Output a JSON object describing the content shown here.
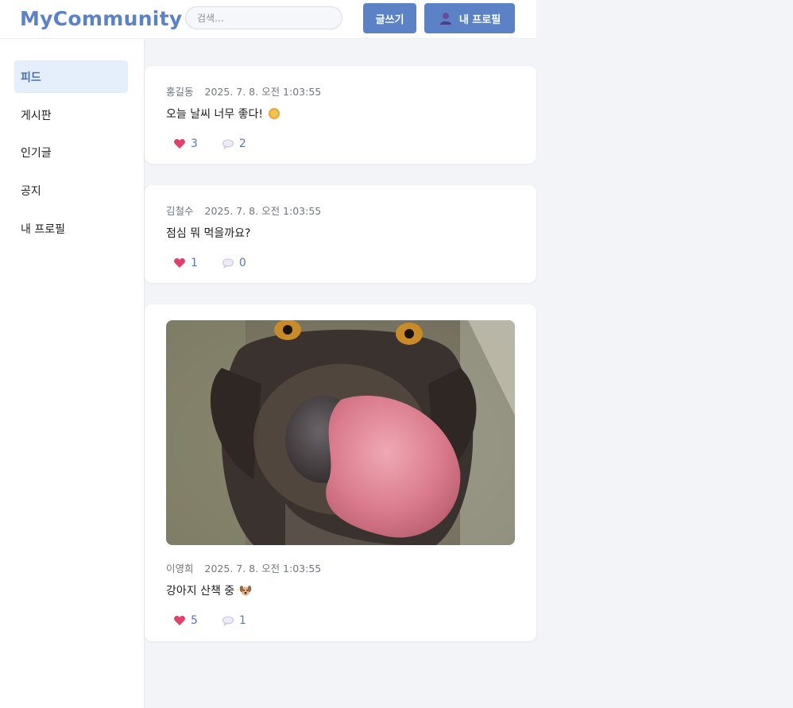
{
  "header": {
    "logo": "MyCommunity",
    "search_placeholder": "검색...",
    "write_label": "글쓰기",
    "profile_label": "내 프로필",
    "profile_icon": "person-icon"
  },
  "sidebar": {
    "items": [
      {
        "label": "피드",
        "active": true
      },
      {
        "label": "게시판",
        "active": false
      },
      {
        "label": "인기글",
        "active": false
      },
      {
        "label": "공지",
        "active": false
      },
      {
        "label": "내 프로필",
        "active": false
      }
    ]
  },
  "posts": [
    {
      "author": "홍길동",
      "time": "2025. 7. 8. 오전 1:03:55",
      "text": "오늘 날씨 너무 좋다!",
      "text_emoji": "sun-icon",
      "likes": "3",
      "comments": "2",
      "has_image": false
    },
    {
      "author": "김철수",
      "time": "2025. 7. 8. 오전 1:03:55",
      "text": "점심 뭐 먹을까요?",
      "text_emoji": "",
      "likes": "1",
      "comments": "0",
      "has_image": false
    },
    {
      "author": "이영희",
      "time": "2025. 7. 8. 오전 1:03:55",
      "text": "강아지 산책 중",
      "text_emoji": "dog-face-icon",
      "likes": "5",
      "comments": "1",
      "has_image": true,
      "image_icon": "dog-photo"
    }
  ],
  "colors": {
    "accent": "#5b82c4",
    "active_nav_bg": "#e5eefb",
    "page_bg": "#f3f4f8",
    "heart": "#e0406a"
  }
}
